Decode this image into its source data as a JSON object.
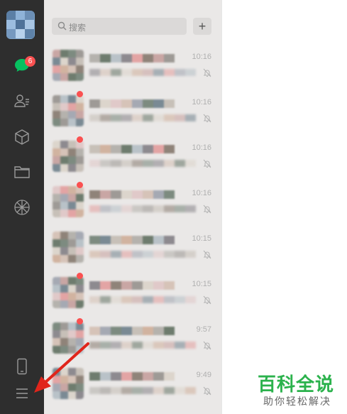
{
  "sidebar": {
    "chat_badge": "6",
    "icons": [
      "chat-icon",
      "contacts-icon",
      "mini-program-icon",
      "folder-icon",
      "moments-icon",
      "phone-icon",
      "menu-icon"
    ]
  },
  "search": {
    "placeholder": "搜索"
  },
  "add_label": "+",
  "chats": [
    {
      "time": "10:16",
      "unread_dot": false,
      "muted": true
    },
    {
      "time": "10:16",
      "unread_dot": true,
      "muted": true
    },
    {
      "time": "10:16",
      "unread_dot": true,
      "muted": true
    },
    {
      "time": "10:16",
      "unread_dot": true,
      "muted": true
    },
    {
      "time": "10:15",
      "unread_dot": false,
      "muted": true
    },
    {
      "time": "10:15",
      "unread_dot": true,
      "muted": true
    },
    {
      "time": "9:57",
      "unread_dot": true,
      "muted": true
    },
    {
      "time": "9:49",
      "unread_dot": false,
      "muted": true
    }
  ],
  "watermark": {
    "main": "百科全说",
    "sub": "助你轻松解决"
  },
  "colors": {
    "sidebar": "#2e2e2e",
    "list": "#eae8e7",
    "badge": "#fa5151",
    "watermark": "#2bb24c",
    "arrow": "#e0251b"
  }
}
